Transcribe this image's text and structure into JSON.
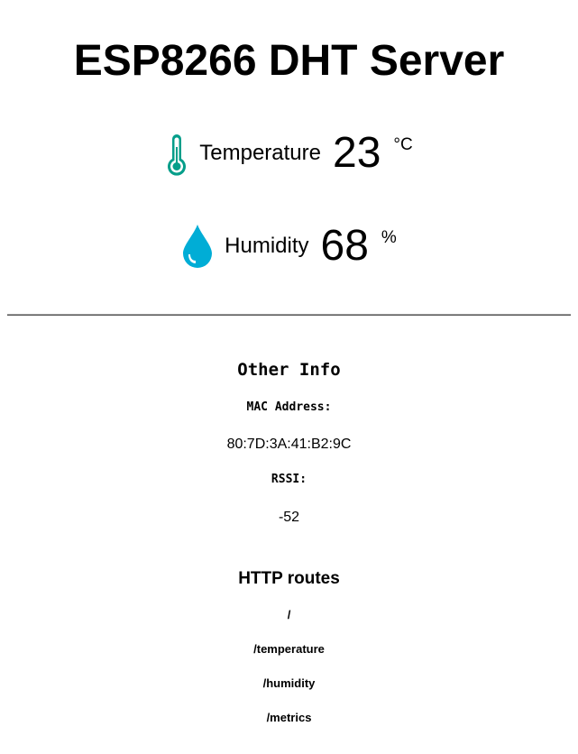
{
  "page": {
    "title": "ESP8266 DHT Server"
  },
  "readings": {
    "temperature": {
      "icon": "thermometer-icon",
      "label": "Temperature",
      "value": "23",
      "unit": "°C",
      "color": "#059e8a"
    },
    "humidity": {
      "icon": "water-drop-icon",
      "label": "Humidity",
      "value": "68",
      "unit": "%",
      "color": "#00add6"
    }
  },
  "other_info": {
    "title": "Other Info",
    "mac_label": "MAC Address:",
    "mac_value": "80:7D:3A:41:B2:9C",
    "rssi_label": "RSSI:",
    "rssi_value": "-52"
  },
  "http_routes": {
    "title": "HTTP routes",
    "routes": [
      "/",
      "/temperature",
      "/humidity",
      "/metrics"
    ]
  }
}
